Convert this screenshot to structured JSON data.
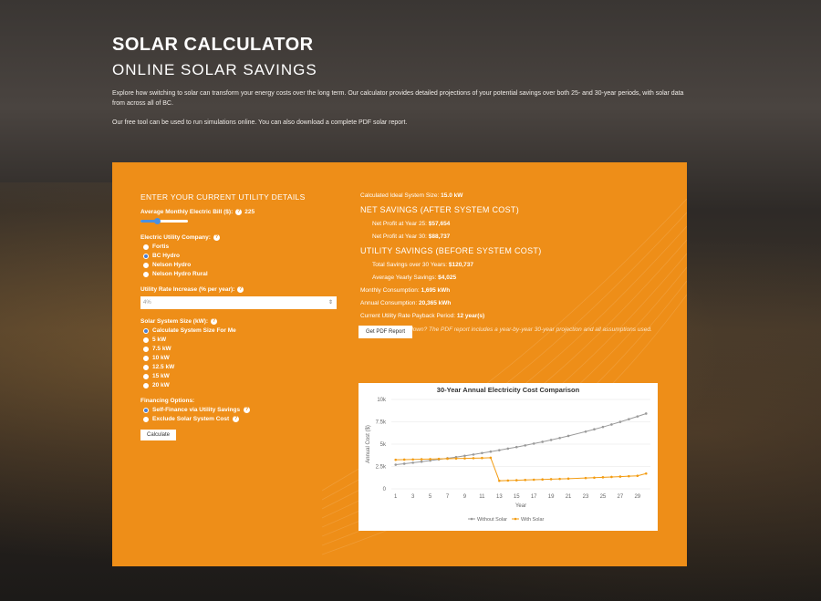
{
  "hero": {
    "title": "SOLAR CALCULATOR",
    "subtitle": "ONLINE SOLAR SAVINGS",
    "p1": "Explore how switching to solar can transform your energy costs over the long term. Our calculator provides detailed projections of your potential savings over both 25- and 30-year periods, with solar data from across all of BC.",
    "p2": "Our free tool can be used to run simulations online. You can also download a complete PDF solar report."
  },
  "form": {
    "section_title": "ENTER YOUR CURRENT UTILITY DETAILS",
    "bill_label": "Average Monthly Electric Bill ($):",
    "bill_value": "225",
    "bill_fraction": 0.35,
    "utility_label": "Electric Utility Company:",
    "utilities": [
      "Fortis",
      "BC Hydro",
      "Nelson Hydro",
      "Nelson Hydro Rural"
    ],
    "utility_selected": 1,
    "rate_label": "Utility Rate Increase (% per year):",
    "rate_value": "4%",
    "size_label": "Solar System Size (kW):",
    "sizes": [
      "Calculate System Size For Me",
      "5 kW",
      "7.5 kW",
      "10 kW",
      "12.5 kW",
      "15 kW",
      "20 kW"
    ],
    "size_selected": 0,
    "financing_label": "Financing Options:",
    "financing": [
      "Self-Finance via Utility Savings",
      "Exclude Solar System Cost"
    ],
    "financing_selected": 0,
    "calculate": "Calculate"
  },
  "results": {
    "ideal": "Calculated Ideal System Size:",
    "ideal_val": "15.0 kW",
    "net_title": "NET SAVINGS (AFTER SYSTEM COST)",
    "p25": "Net Profit at Year 25:",
    "p25_val": "$57,654",
    "p30": "Net Profit at Year 30:",
    "p30_val": "$88,737",
    "util_title": "UTILITY SAVINGS (BEFORE SYSTEM COST)",
    "total": "Total Savings over 30 Years:",
    "total_val": "$120,737",
    "yearly": "Average Yearly Savings:",
    "yearly_val": "$4,025",
    "monthly": "Monthly Consumption:",
    "monthly_val": "1,695 kWh",
    "annual": "Annual Consumption:",
    "annual_val": "20,365 kWh",
    "payback": "Current Utility Rate Payback Period:",
    "payback_val": "12 year(s)",
    "note": "Want the full breakdown? The PDF report includes a year-by-year 30-year projection and all assumptions used.",
    "pdf_button": "Get PDF Report"
  },
  "chart_data": {
    "type": "line",
    "title": "30-Year Annual Electricity Cost Comparison",
    "xlabel": "Year",
    "ylabel": "Annual Cost ($)",
    "ylim": [
      0,
      10000
    ],
    "yticks": [
      "0",
      "2.5k",
      "5k",
      "7.5k",
      "10k"
    ],
    "xticks": [
      1,
      3,
      5,
      7,
      9,
      11,
      13,
      15,
      17,
      19,
      21,
      23,
      25,
      27,
      29
    ],
    "x": [
      1,
      2,
      3,
      4,
      5,
      6,
      7,
      8,
      9,
      10,
      11,
      12,
      13,
      14,
      15,
      16,
      17,
      18,
      19,
      20,
      21,
      23,
      24,
      25,
      26,
      27,
      28,
      29,
      30
    ],
    "series": [
      {
        "name": "Without Solar",
        "color": "#9a9a9a",
        "values": [
          2700,
          2810,
          2920,
          3040,
          3160,
          3290,
          3420,
          3550,
          3700,
          3840,
          4000,
          4160,
          4320,
          4500,
          4670,
          4860,
          5060,
          5260,
          5470,
          5690,
          5920,
          6400,
          6660,
          6920,
          7200,
          7490,
          7790,
          8100,
          8420
        ]
      },
      {
        "name": "With Solar",
        "color": "#f39c12",
        "values": [
          3250,
          3270,
          3290,
          3310,
          3330,
          3350,
          3370,
          3390,
          3410,
          3430,
          3450,
          3480,
          900,
          930,
          960,
          990,
          1020,
          1050,
          1080,
          1110,
          1140,
          1210,
          1250,
          1290,
          1330,
          1370,
          1410,
          1460,
          1710
        ]
      }
    ],
    "legend": "bottom"
  }
}
